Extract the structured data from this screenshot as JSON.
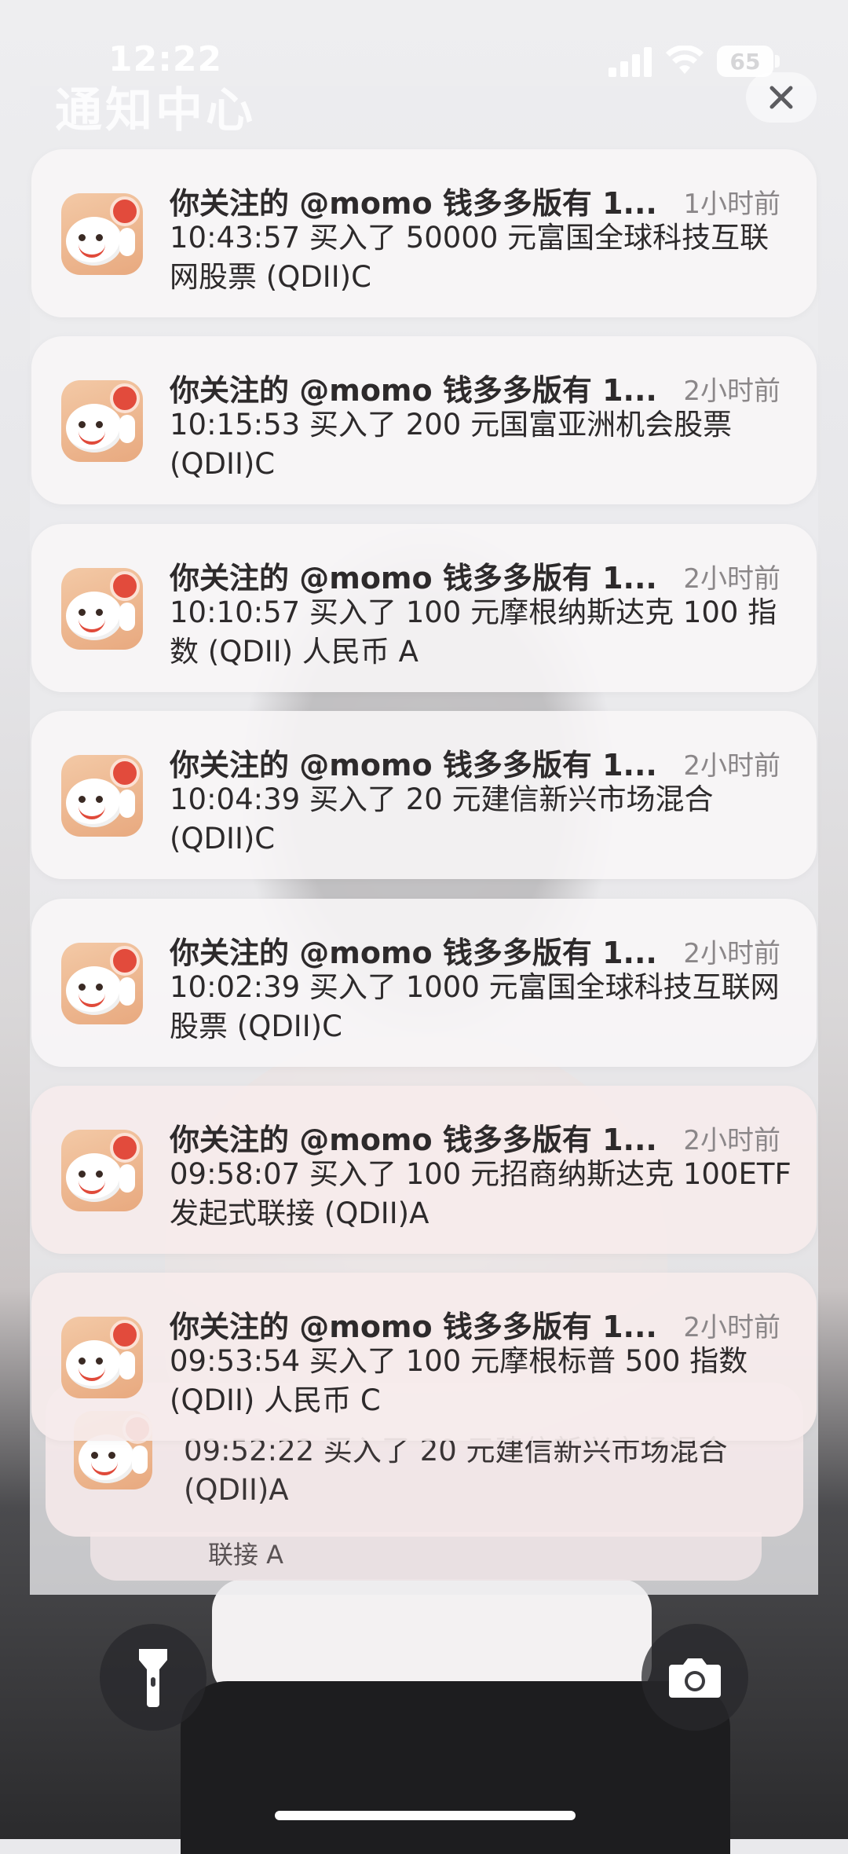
{
  "status_bar": {
    "time": "12:22",
    "battery": "65"
  },
  "header": {
    "title": "通知中心",
    "close_icon": "close-icon"
  },
  "notifications": [
    {
      "title": "你关注的 @momo 钱多多版有 1...",
      "time": "1小时前",
      "body": "10:43:57 买入了 50000 元富国全球科技互联网股票 (QDII)C"
    },
    {
      "title": "你关注的 @momo 钱多多版有 1...",
      "time": "2小时前",
      "body": "10:15:53 买入了 200 元国富亚洲机会股票 (QDII)C"
    },
    {
      "title": "你关注的 @momo 钱多多版有 1...",
      "time": "2小时前",
      "body": "10:10:57 买入了 100 元摩根纳斯达克 100 指数 (QDII) 人民币 A"
    },
    {
      "title": "你关注的 @momo 钱多多版有 1...",
      "time": "2小时前",
      "body": "10:04:39 买入了 20 元建信新兴市场混合 (QDII)C"
    },
    {
      "title": "你关注的 @momo 钱多多版有 1...",
      "time": "2小时前",
      "body": "10:02:39 买入了 1000 元富国全球科技互联网股票 (QDII)C"
    },
    {
      "title": "你关注的 @momo 钱多多版有 1...",
      "time": "2小时前",
      "body": "09:58:07 买入了 100 元招商纳斯达克 100ETF 发起式联接 (QDII)A"
    },
    {
      "title": "你关注的 @momo 钱多多版有 1...",
      "time": "2小时前",
      "body": "09:53:54 买入了 100 元摩根标普 500 指数 (QDII) 人民币 C"
    }
  ],
  "stacked": [
    {
      "body": "09:52:22 买入了 20 元建信新兴市场混合 (QDII)A"
    },
    {
      "body": "联接 A"
    }
  ],
  "bottom": {
    "flashlight_icon": "flashlight-icon",
    "camera_icon": "camera-icon"
  }
}
